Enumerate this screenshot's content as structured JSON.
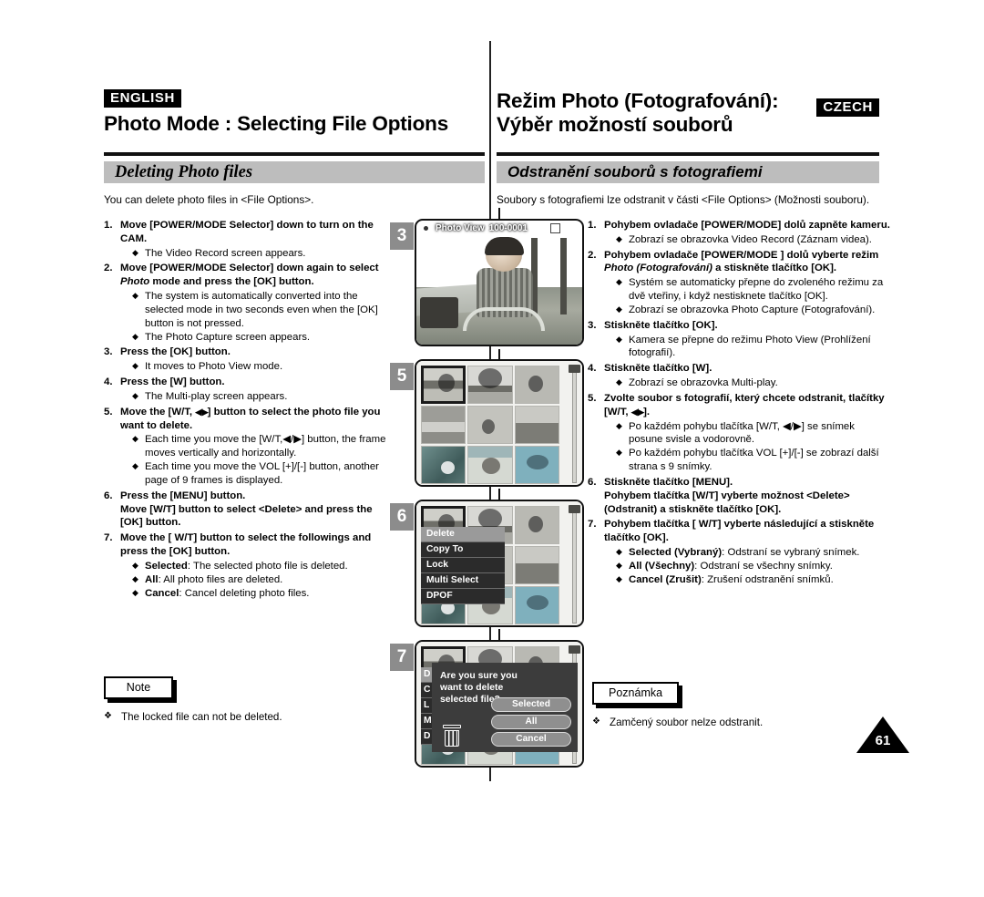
{
  "header": {
    "left_lang": "ENGLISH",
    "left_title": "Photo Mode : Selecting File Options",
    "right_lang": "CZECH",
    "right_title": "Režim Photo (Fotografování):\nVýběr možností souborů"
  },
  "section": {
    "left_bar": "Deleting Photo files",
    "left_intro": "You can delete photo files in <File Options>.",
    "right_bar": "Odstranění souborů s fotografiemi",
    "right_intro": "Soubory s fotografiemi lze odstranit v části <File Options> (Možnosti souboru)."
  },
  "english_steps": [
    {
      "num": "1.",
      "head": "Move [POWER/MODE Selector] down to turn on the CAM.",
      "bullets": [
        "The Video Record screen appears."
      ]
    },
    {
      "num": "2.",
      "head_pre": "Move [POWER/MODE Selector] down again to select ",
      "head_italic": "Photo",
      "head_post": " mode and press the [OK] button.",
      "bullets": [
        "The system is automatically converted into the selected mode in two seconds even when the [OK] button is not pressed.",
        "The Photo Capture screen appears."
      ]
    },
    {
      "num": "3.",
      "head": "Press the [OK] button.",
      "bullets": [
        "It moves to Photo View mode."
      ]
    },
    {
      "num": "4.",
      "head": "Press the [W] button.",
      "bullets": [
        "The Multi-play screen appears."
      ]
    },
    {
      "num": "5.",
      "head_pre": "Move the [W/T, ",
      "head_arrow": "◀/▶",
      "head_post": "] button to select the photo file you want to delete.",
      "bullets": [
        "Each time you move the [W/T,◀/▶] button, the frame moves vertically and horizontally.",
        "Each time you move the VOL [+]/[-] button, another page of 9 frames is displayed."
      ]
    },
    {
      "num": "6.",
      "head": "Press the [MENU] button.\nMove [W/T] button to select <Delete> and press the [OK] button.",
      "bullets": []
    },
    {
      "num": "7.",
      "head": "Move the [ W/T] button to select the followings and press the [OK] button.",
      "bullets": [
        {
          "bold": "Selected",
          "rest": ": The selected photo file is deleted."
        },
        {
          "bold": "All",
          "rest": ": All photo files are deleted."
        },
        {
          "bold": "Cancel",
          "rest": ": Cancel deleting photo files."
        }
      ]
    }
  ],
  "czech_steps": [
    {
      "num": "1.",
      "head": "Pohybem ovladače [POWER/MODE] dolů zapněte kameru.",
      "bullets": [
        "Zobrazí se obrazovka Video Record (Záznam videa)."
      ]
    },
    {
      "num": "2.",
      "head_pre": "Pohybem ovladače [POWER/MODE ] dolů vyberte režim ",
      "head_italic": "Photo (Fotografování)",
      "head_post": " a stiskněte tlačítko [OK].",
      "bullets": [
        "Systém se automaticky přepne do zvoleného režimu za dvě vteřiny, i když nestisknete tlačítko [OK].",
        "Zobrazí se obrazovka Photo Capture (Fotografování)."
      ]
    },
    {
      "num": "3.",
      "head": "Stiskněte tlačítko [OK].",
      "bullets": [
        "Kamera se přepne do režimu Photo View (Prohlížení fotografií)."
      ]
    },
    {
      "num": "4.",
      "head": "Stiskněte tlačítko [W].",
      "bullets": [
        "Zobrazí se obrazovka Multi-play."
      ]
    },
    {
      "num": "5.",
      "head_pre": "Zvolte soubor s fotografií, který chcete odstranit, tlačítky [W/T, ",
      "head_arrow": "◀/▶",
      "head_post": "].",
      "bullets": [
        "Po každém pohybu tlačítka [W/T, ◀/▶] se snímek posune svisle a vodorovně.",
        "Po každém pohybu tlačítka VOL [+]/[-] se zobrazí další strana s 9 snímky."
      ]
    },
    {
      "num": "6.",
      "head": "Stiskněte tlačítko [MENU].\nPohybem tlačítka [W/T] vyberte možnost <Delete> (Odstranit) a stiskněte tlačítko [OK].",
      "bullets": []
    },
    {
      "num": "7.",
      "head": "Pohybem tlačítka [ W/T] vyberte následující a stiskněte tlačítko [OK].",
      "bullets": [
        {
          "bold": "Selected (Vybraný)",
          "rest": ": Odstraní se vybraný snímek."
        },
        {
          "bold": "All (Všechny)",
          "rest": ": Odstraní se všechny snímky."
        },
        {
          "bold": "Cancel (Zrušit)",
          "rest": ": Zrušení odstranění snímků."
        }
      ]
    }
  ],
  "note_left": {
    "title": "Note",
    "line": "The locked file can not be deleted."
  },
  "note_right": {
    "title": "Poznámka",
    "line": "Zamčený soubor nelze odstranit."
  },
  "page_number": "61",
  "screens": {
    "step3": {
      "badge": "3",
      "title": "Photo View",
      "file": "100-0001"
    },
    "step5": {
      "badge": "5"
    },
    "step6": {
      "badge": "6",
      "menu": [
        "Delete",
        "Copy To",
        "Lock",
        "Multi Select",
        "DPOF"
      ],
      "selected_index": 0
    },
    "step7": {
      "badge": "7",
      "message": "Are you sure you want to delete selected file?",
      "buttons": [
        "Selected",
        "All",
        "Cancel"
      ],
      "menu_stub": [
        "D",
        "C",
        "L",
        "M",
        "D"
      ]
    }
  }
}
